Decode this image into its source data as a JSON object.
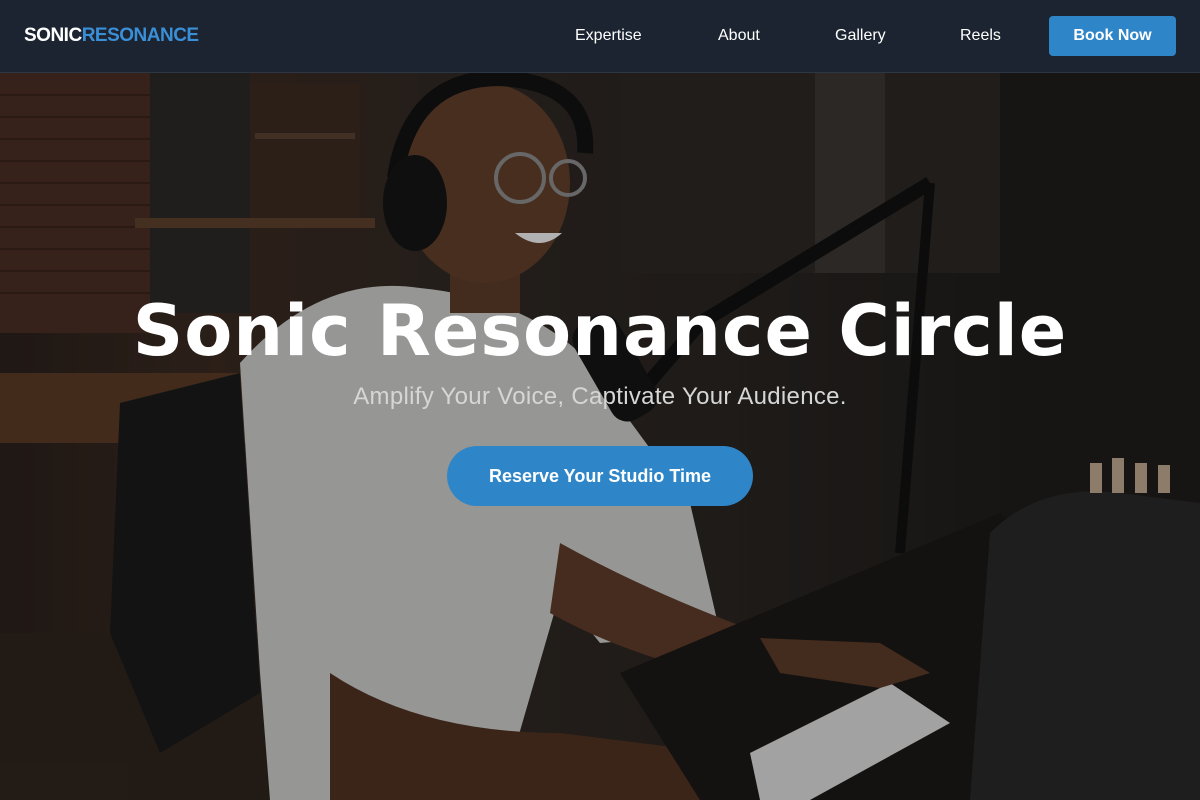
{
  "brand": {
    "word1": "SONIC",
    "word2": "RESONANCE",
    "accent_color": "#3a8fd6"
  },
  "nav": {
    "links": [
      "Expertise",
      "About",
      "Gallery",
      "Reels"
    ],
    "book_label": "Book Now",
    "background_color": "#1b2430",
    "button_color": "#2e86c9"
  },
  "hero": {
    "title": "Sonic Resonance Circle",
    "subtitle": "Amplify Your Voice, Captivate Your Audience.",
    "cta_label": "Reserve Your Studio Time",
    "background_image": "podcast-studio-photo",
    "cta_color": "#2e86c9"
  }
}
